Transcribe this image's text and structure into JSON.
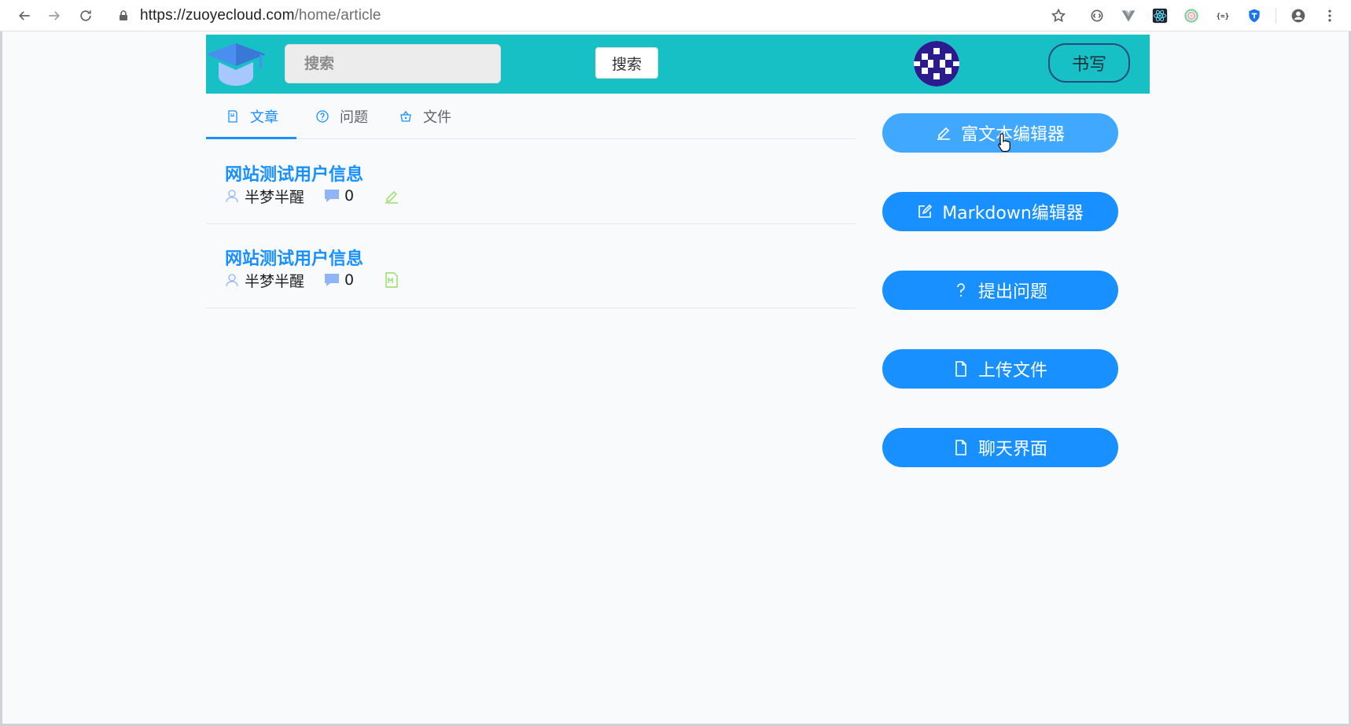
{
  "browser": {
    "url_host": "https://zuoyecloud.com",
    "url_path": "/home/article",
    "icons": [
      "back-icon",
      "forward-icon",
      "reload-icon",
      "lock-icon",
      "star-icon",
      "extension-icon",
      "vue-devtools-icon",
      "react-devtools-icon",
      "color-picker-icon",
      "json-icon",
      "shield-icon",
      "account-icon",
      "menu-icon"
    ]
  },
  "header": {
    "search_placeholder": "搜索",
    "search_button": "搜索",
    "write_button": "书写",
    "brand_color": "#17c0c4"
  },
  "tabs": [
    {
      "label": "文章",
      "icon": "document-icon",
      "active": true
    },
    {
      "label": "问题",
      "icon": "question-circle-icon",
      "active": false
    },
    {
      "label": "文件",
      "icon": "basket-icon",
      "active": false
    }
  ],
  "articles": [
    {
      "title": "网站测试用户信息",
      "author": "半梦半醒",
      "comments": "0",
      "type_icon": "edit-icon"
    },
    {
      "title": "网站测试用户信息",
      "author": "半梦半醒",
      "comments": "0",
      "type_icon": "markdown-file-icon"
    }
  ],
  "actions": [
    {
      "label": "富文本编辑器",
      "icon": "edit-icon"
    },
    {
      "label": "Markdown编辑器",
      "icon": "edit-square-icon"
    },
    {
      "label": "提出问题",
      "icon": "question-icon"
    },
    {
      "label": "上传文件",
      "icon": "file-icon"
    },
    {
      "label": "聊天界面",
      "icon": "file-icon"
    }
  ],
  "colors": {
    "primary": "#1890ff",
    "primary_hover": "#40a9ff",
    "header_bg": "#17c0c4"
  }
}
